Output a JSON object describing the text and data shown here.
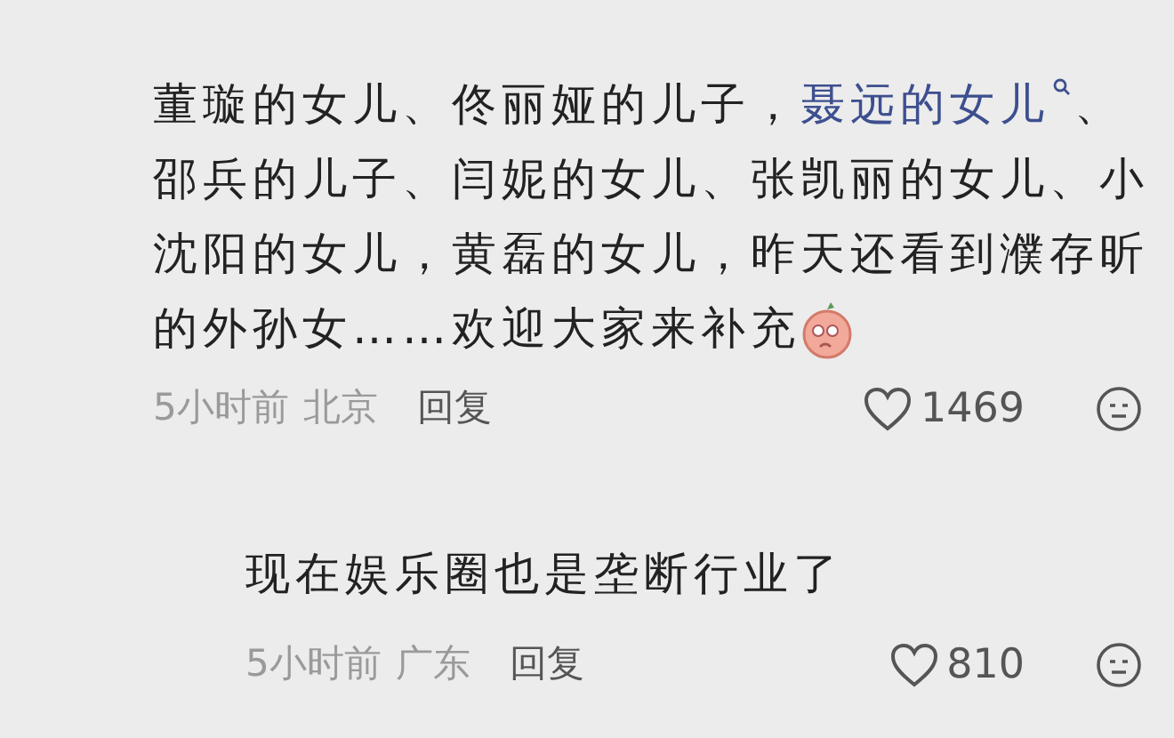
{
  "comments": [
    {
      "text_before": "董璇的女儿、佟丽娅的儿子，",
      "link": "聂远的女儿",
      "text_after": "、邵兵的儿子、闫妮的女儿、张凯丽的女儿、小沈阳的女儿，黄磊的女儿，昨天还看到濮存昕的外孙女……欢迎大家来补充",
      "sticker": true,
      "time": "5小时前",
      "location": "北京",
      "reply": "回复",
      "likes": "1469",
      "replies": [
        {
          "text_before": "现在娱乐圈也是垄断行业了",
          "time": "5小时前",
          "location": "广东",
          "reply": "回复",
          "likes": "810"
        }
      ]
    }
  ]
}
